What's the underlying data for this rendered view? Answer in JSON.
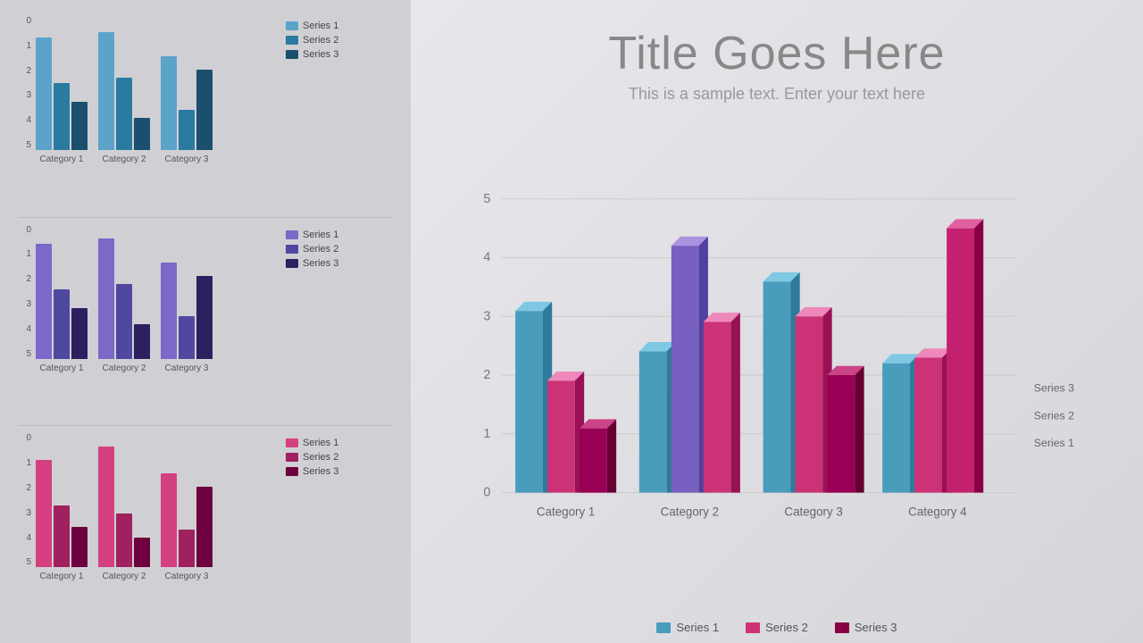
{
  "left": {
    "charts": [
      {
        "id": "chart1",
        "colorScheme": "blue",
        "yLabels": [
          "0",
          "1",
          "2",
          "3",
          "4",
          "5"
        ],
        "categories": [
          {
            "label": "Category 1",
            "bars": [
              {
                "series": 1,
                "value": 4.2,
                "heightPct": 84
              },
              {
                "series": 2,
                "value": 2.5,
                "heightPct": 50
              },
              {
                "series": 3,
                "value": 1.8,
                "heightPct": 36
              }
            ]
          },
          {
            "label": "Category 2",
            "bars": [
              {
                "series": 1,
                "value": 4.4,
                "heightPct": 88
              },
              {
                "series": 2,
                "value": 2.7,
                "heightPct": 54
              },
              {
                "series": 3,
                "value": 1.2,
                "heightPct": 24
              }
            ]
          },
          {
            "label": "Category 3",
            "bars": [
              {
                "series": 1,
                "value": 3.5,
                "heightPct": 70
              },
              {
                "series": 2,
                "value": 1.5,
                "heightPct": 30
              },
              {
                "series": 3,
                "value": 3.0,
                "heightPct": 60
              }
            ]
          }
        ],
        "legend": [
          {
            "label": "Series 1",
            "color": "blue-s1"
          },
          {
            "label": "Series 2",
            "color": "blue-s2"
          },
          {
            "label": "Series 3",
            "color": "blue-s3"
          }
        ]
      },
      {
        "id": "chart2",
        "colorScheme": "purple",
        "yLabels": [
          "0",
          "1",
          "2",
          "3",
          "4",
          "5"
        ],
        "categories": [
          {
            "label": "Category 1",
            "bars": [
              {
                "series": 1,
                "value": 4.3,
                "heightPct": 86
              },
              {
                "series": 2,
                "value": 2.6,
                "heightPct": 52
              },
              {
                "series": 3,
                "value": 1.9,
                "heightPct": 38
              }
            ]
          },
          {
            "label": "Category 2",
            "bars": [
              {
                "series": 1,
                "value": 4.5,
                "heightPct": 90
              },
              {
                "series": 2,
                "value": 2.8,
                "heightPct": 56
              },
              {
                "series": 3,
                "value": 1.3,
                "heightPct": 26
              }
            ]
          },
          {
            "label": "Category 3",
            "bars": [
              {
                "series": 1,
                "value": 3.6,
                "heightPct": 72
              },
              {
                "series": 2,
                "value": 1.6,
                "heightPct": 32
              },
              {
                "series": 3,
                "value": 3.1,
                "heightPct": 62
              }
            ]
          }
        ],
        "legend": [
          {
            "label": "Series 1",
            "color": "purple-s1"
          },
          {
            "label": "Series 2",
            "color": "purple-s2"
          },
          {
            "label": "Series 3",
            "color": "purple-s3"
          }
        ]
      },
      {
        "id": "chart3",
        "colorScheme": "pink",
        "yLabels": [
          "0",
          "1",
          "2",
          "3",
          "4",
          "5"
        ],
        "categories": [
          {
            "label": "Category 1",
            "bars": [
              {
                "series": 1,
                "value": 4.0,
                "heightPct": 80
              },
              {
                "series": 2,
                "value": 2.3,
                "heightPct": 46
              },
              {
                "series": 3,
                "value": 1.5,
                "heightPct": 30
              }
            ]
          },
          {
            "label": "Category 2",
            "bars": [
              {
                "series": 1,
                "value": 4.5,
                "heightPct": 90
              },
              {
                "series": 2,
                "value": 2.0,
                "heightPct": 40
              },
              {
                "series": 3,
                "value": 1.1,
                "heightPct": 22
              }
            ]
          },
          {
            "label": "Category 3",
            "bars": [
              {
                "series": 1,
                "value": 3.5,
                "heightPct": 70
              },
              {
                "series": 2,
                "value": 1.4,
                "heightPct": 28
              },
              {
                "series": 3,
                "value": 3.0,
                "heightPct": 60
              }
            ]
          }
        ],
        "legend": [
          {
            "label": "Series 1",
            "color": "pink-s1"
          },
          {
            "label": "Series 2",
            "color": "pink-s2"
          },
          {
            "label": "Series 3",
            "color": "pink-s3"
          }
        ]
      }
    ]
  },
  "right": {
    "title": "Title Goes Here",
    "subtitle": "This is a sample text. Enter your text here",
    "chart3d": {
      "yLabels": [
        "0",
        "1",
        "2",
        "3",
        "4",
        "5"
      ],
      "categories": [
        {
          "label": "Category 1",
          "series1Height": 62,
          "series2Height": 38,
          "series3Height": 22
        },
        {
          "label": "Category 2",
          "series1Height": 48,
          "series2Height": 84,
          "series3Height": 58
        },
        {
          "label": "Category 3",
          "series1Height": 72,
          "series2Height": 60,
          "series3Height": 40
        },
        {
          "label": "Category 4",
          "series1Height": 44,
          "series2Height": 46,
          "series3Height": 90
        }
      ],
      "rightLegend": [
        {
          "label": "Series 3"
        },
        {
          "label": "Series 2"
        },
        {
          "label": "Series 1"
        }
      ],
      "bottomLegend": [
        {
          "label": "Series 1",
          "colorClass": "blue-s2"
        },
        {
          "label": "Series 2",
          "colorClass": "pink-s1"
        },
        {
          "label": "Series 3",
          "colorClass": "pink-s3"
        }
      ]
    }
  }
}
